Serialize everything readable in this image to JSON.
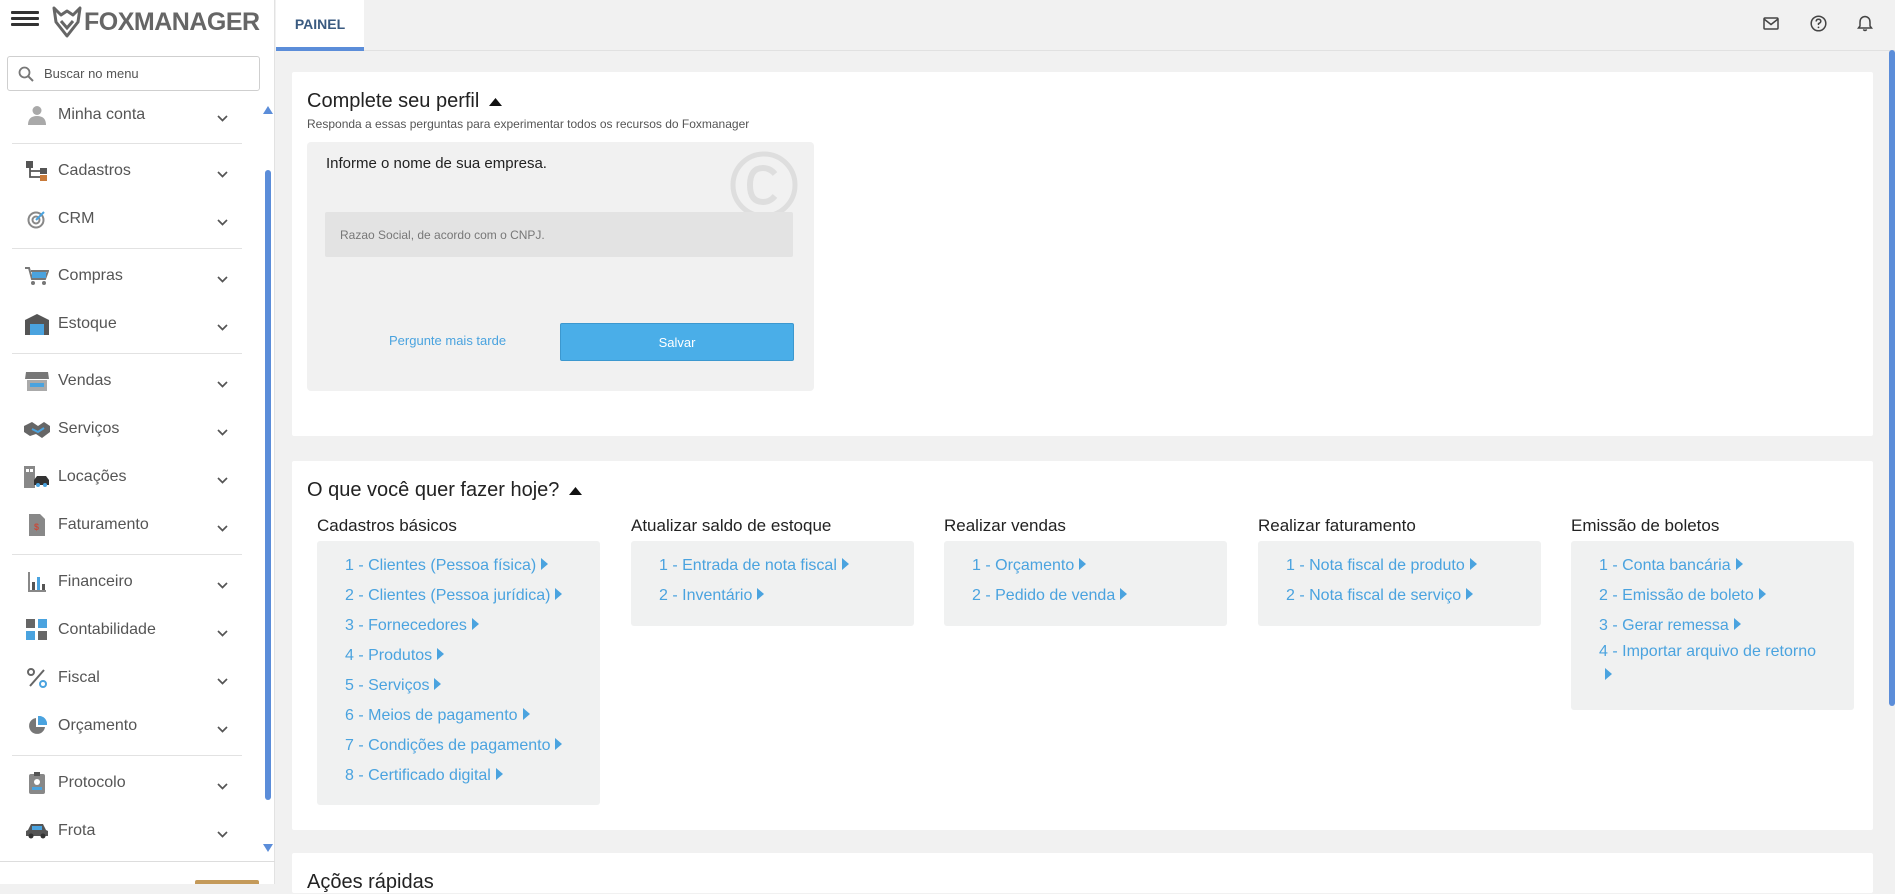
{
  "app": {
    "logo_text": "FOXMANAGER"
  },
  "search": {
    "placeholder": "Buscar no menu"
  },
  "sidebar": {
    "items": [
      {
        "label": "Minha conta",
        "icon": "user-icon"
      },
      {
        "label": "Cadastros",
        "icon": "sitemap-icon"
      },
      {
        "label": "CRM",
        "icon": "target-icon"
      },
      {
        "label": "Compras",
        "icon": "cart-icon"
      },
      {
        "label": "Estoque",
        "icon": "warehouse-icon"
      },
      {
        "label": "Vendas",
        "icon": "store-icon"
      },
      {
        "label": "Serviços",
        "icon": "handshake-icon"
      },
      {
        "label": "Locações",
        "icon": "building-car-icon"
      },
      {
        "label": "Faturamento",
        "icon": "invoice-icon"
      },
      {
        "label": "Financeiro",
        "icon": "bar-chart-icon"
      },
      {
        "label": "Contabilidade",
        "icon": "calculator-icon"
      },
      {
        "label": "Fiscal",
        "icon": "percent-icon"
      },
      {
        "label": "Orçamento",
        "icon": "pie-chart-icon"
      },
      {
        "label": "Protocolo",
        "icon": "id-badge-icon"
      },
      {
        "label": "Frota",
        "icon": "car-icon"
      }
    ]
  },
  "topbar": {
    "tab_label": "PAINEL",
    "icons": [
      "mail-icon",
      "help-icon",
      "bell-icon"
    ]
  },
  "profile": {
    "title": "Complete seu perfil",
    "subtitle": "Responda a essas perguntas para experimentar todos os recursos do Foxmanager",
    "question": "Informe o nome de sua empresa.",
    "input_placeholder": "Razao Social, de acordo com o CNPJ.",
    "later_label": "Pergunte mais tarde",
    "save_label": "Salvar"
  },
  "today": {
    "title": "O que você quer fazer hoje?",
    "columns": [
      {
        "title": "Cadastros básicos",
        "links": [
          "1 - Clientes (Pessoa física)",
          "2 - Clientes (Pessoa jurídica)",
          "3 - Fornecedores",
          "4 - Produtos",
          "5 - Serviços",
          "6 - Meios de pagamento",
          "7 - Condições de pagamento",
          "8 - Certificado digital"
        ]
      },
      {
        "title": "Atualizar saldo de estoque",
        "links": [
          "1 - Entrada de nota fiscal",
          "2 - Inventário"
        ]
      },
      {
        "title": "Realizar vendas",
        "links": [
          "1 - Orçamento",
          "2 - Pedido de venda"
        ]
      },
      {
        "title": "Realizar faturamento",
        "links": [
          "1 - Nota fiscal de produto",
          "2 - Nota fiscal de serviço"
        ]
      },
      {
        "title": "Emissão de boletos",
        "links": [
          "1 - Conta bancária",
          "2 - Emissão de boleto",
          "3 - Gerar remessa",
          "4 - Importar arquivo de retorno"
        ]
      }
    ]
  },
  "quick_actions": {
    "title": "Ações rápidas"
  },
  "colors": {
    "accent": "#4aa3df",
    "tab_underline": "#5b8dd9",
    "save_button": "#4aaee8"
  }
}
